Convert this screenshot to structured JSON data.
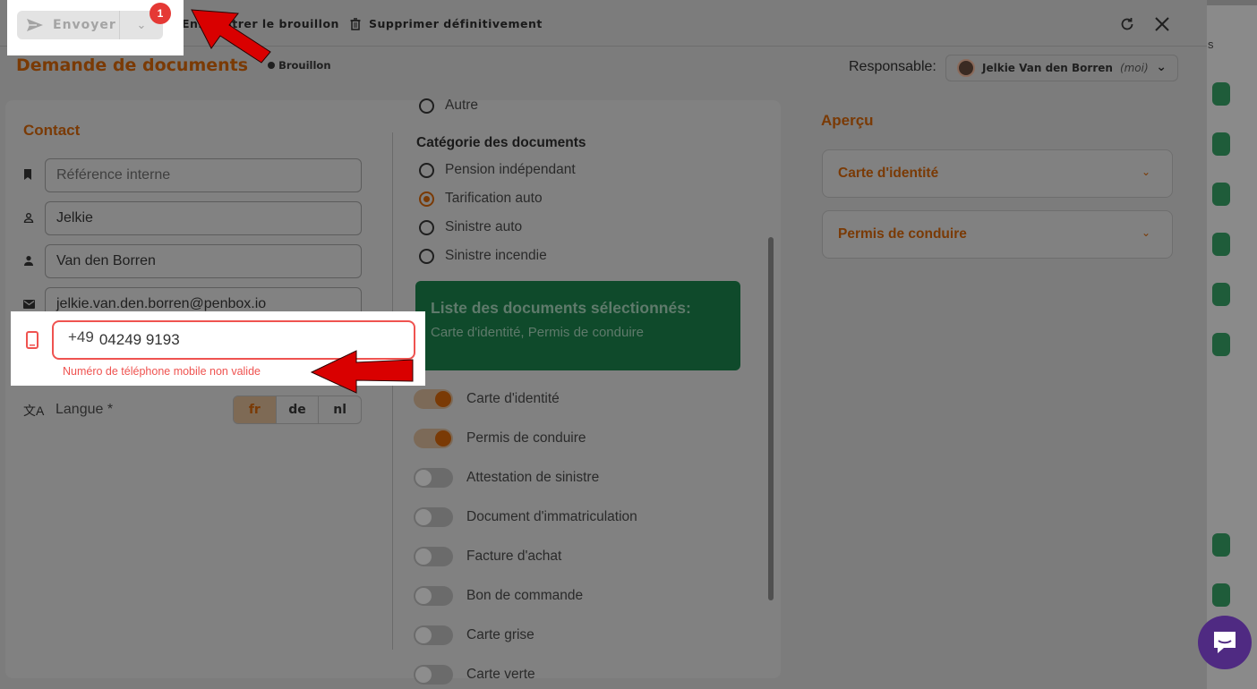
{
  "toolbar": {
    "send_label": "Envoyer",
    "badge_count": "1",
    "save_draft_label": "Enregistrer le brouillon",
    "delete_label": "Supprimer définitivement"
  },
  "header": {
    "title": "Demande de documents",
    "status": "Brouillon",
    "responsible_label": "Responsable:",
    "responsible_name": "Jelkie Van den Borren",
    "responsible_suffix": "(moi)"
  },
  "contact": {
    "section_title": "Contact",
    "reference_placeholder": "Référence interne",
    "first_name": "Jelkie",
    "last_name": "Van den Borren",
    "email": "jelkie.van.den.borren@penbox.io",
    "phone_country_code": "+49",
    "phone_number": "04249 9193",
    "phone_error": "Numéro de téléphone mobile non valide",
    "language_label": "Langue *",
    "languages": [
      "fr",
      "de",
      "nl"
    ],
    "selected_language": "fr"
  },
  "documents": {
    "other_option": "Autre",
    "category_title": "Catégorie des documents",
    "categories": [
      {
        "label": "Pension indépendant",
        "checked": false
      },
      {
        "label": "Tarification auto",
        "checked": true
      },
      {
        "label": "Sinistre auto",
        "checked": false
      },
      {
        "label": "Sinistre incendie",
        "checked": false
      }
    ],
    "selected_box_title": "Liste des documents sélectionnés:",
    "selected_box_list": "Carte d'identité, Permis de conduire",
    "toggles": [
      {
        "label": "Carte d'identité",
        "on": true
      },
      {
        "label": "Permis de conduire",
        "on": true
      },
      {
        "label": "Attestation de sinistre",
        "on": false
      },
      {
        "label": "Document d'immatriculation",
        "on": false
      },
      {
        "label": "Facture d'achat",
        "on": false
      },
      {
        "label": "Bon de commande",
        "on": false
      },
      {
        "label": "Carte grise",
        "on": false
      },
      {
        "label": "Carte verte",
        "on": false
      }
    ]
  },
  "preview": {
    "title": "Aperçu",
    "items": [
      "Carte d'identité",
      "Permis de conduire"
    ]
  },
  "colors": {
    "accent": "#e8720c",
    "error": "#ef5350",
    "badge": "#e53935",
    "green_box": "#1fa053",
    "arrow": "#d90000",
    "chat": "#5b2d9c"
  },
  "background": {
    "side_letter": "s"
  }
}
